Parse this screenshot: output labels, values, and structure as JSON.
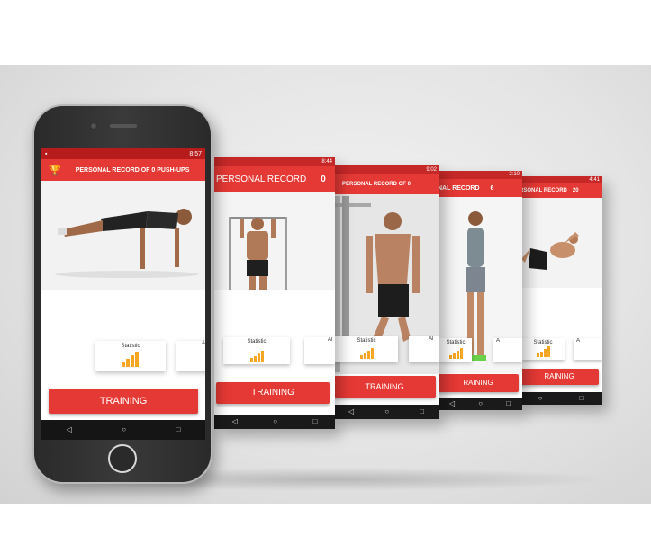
{
  "main_phone": {
    "status_time": "8:57",
    "title": "PERSONAL RECORD OF 0 PUSH-UPS",
    "statistic_label": "Statistic",
    "next_tile_label": "Al",
    "training_label": "TRAINING",
    "trophy_icon": "trophy-icon"
  },
  "screens": [
    {
      "status_time": "8:44",
      "title": "PERSONAL RECORD",
      "record": "0",
      "statistic_label": "Statistic",
      "next_tile_label": "Al",
      "training_label": "TRAINING"
    },
    {
      "status_time": "9:02",
      "title": "PERSONAL RECORD OF 0",
      "statistic_label": "Statistic",
      "next_tile_label": "Al",
      "training_label": "TRAINING"
    },
    {
      "status_time": "2:10",
      "title": "NAL RECORD",
      "record": "6",
      "statistic_label": "Statistic",
      "next_tile_label": "A",
      "training_label": "RAINING"
    },
    {
      "status_time": "4:41",
      "title": "RSONAL RECORD",
      "record": "20",
      "statistic_label": "Statistic",
      "next_tile_label": "A",
      "training_label": "RAINING"
    }
  ],
  "colors": {
    "accent": "#e53935",
    "status_bar": "#b71c1c",
    "stat_bars": "#f5a623"
  }
}
